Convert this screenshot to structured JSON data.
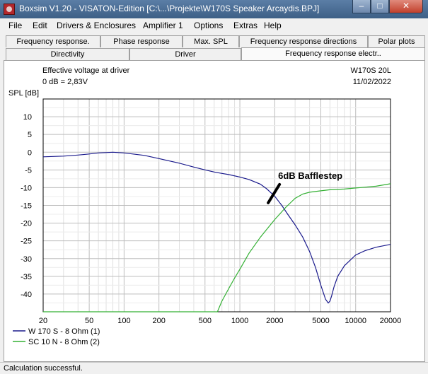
{
  "window": {
    "title": "Boxsim V1.20 - VISATON-Edition [C:\\...\\Projekte\\W170S Speaker Arcaydis.BPJ]",
    "minimize_glyph": "–",
    "maximize_glyph": "□",
    "close_glyph": "✕"
  },
  "menu": [
    "File",
    "Edit",
    "Drivers & Enclosures",
    "Amplifier 1",
    "Options",
    "Extras",
    "Help"
  ],
  "tabs_row1": [
    "Frequency response.",
    "Phase response",
    "Max. SPL",
    "Frequency response directions",
    "Polar plots"
  ],
  "tabs_row2": [
    "Directivity",
    "Driver",
    "Frequency response electr.."
  ],
  "active_tab": "Frequency response electr..",
  "header": {
    "left_line1": "Effective voltage at driver",
    "left_line2": "0 dB = 2,83V",
    "right_line1": "W170S 20L",
    "right_line2": "11/02/2022"
  },
  "status": "Calculation successful.",
  "chart_data": {
    "type": "line",
    "x_scale": "log",
    "xlim": [
      20,
      20000
    ],
    "ylim": [
      -45,
      15
    ],
    "ylabel": "SPL [dB]",
    "grid": true,
    "legend_position": "bottom-left",
    "x_tick_labels": [
      20,
      50,
      100,
      200,
      500,
      1000,
      2000,
      5000,
      10000,
      20000
    ],
    "y_tick_labels": [
      10,
      5,
      0,
      -5,
      -10,
      -15,
      -20,
      -25,
      -30,
      -35,
      -40
    ],
    "annotation": {
      "text": "6dB Bafflestep",
      "at_hz": 2200,
      "at_db": -7.5
    },
    "series": [
      {
        "name": "W 170 S - 8 Ohm (1)",
        "color": "#1a1a8c",
        "x": [
          20,
          30,
          40,
          50,
          60,
          70,
          80,
          100,
          150,
          200,
          300,
          400,
          500,
          600,
          700,
          800,
          1000,
          1200,
          1500,
          1700,
          2000,
          2300,
          2600,
          3000,
          3500,
          4000,
          4500,
          5000,
          5500,
          5800,
          6000,
          6200,
          6500,
          7000,
          8000,
          10000,
          12000,
          15000,
          20000
        ],
        "y": [
          -1.3,
          -1.1,
          -0.8,
          -0.5,
          -0.2,
          -0.1,
          0,
          -0.2,
          -0.9,
          -1.8,
          -3.1,
          -4.2,
          -5,
          -5.6,
          -6,
          -6.3,
          -7,
          -7.7,
          -9,
          -10.3,
          -12.4,
          -15,
          -17.6,
          -20.5,
          -24,
          -28,
          -32.5,
          -37.5,
          -41.5,
          -42.5,
          -42,
          -40.5,
          -38,
          -35,
          -32,
          -29,
          -27.8,
          -26.8,
          -26
        ]
      },
      {
        "name": "SC 10 N - 8 Ohm (2)",
        "color": "#33b033",
        "x": [
          20,
          100,
          300,
          640,
          700,
          800,
          900,
          1000,
          1200,
          1500,
          2000,
          2500,
          3000,
          3500,
          4000,
          5000,
          6000,
          8000,
          10000,
          15000,
          20000
        ],
        "y": [
          -46,
          -46,
          -46,
          -46,
          -42,
          -38.5,
          -35.5,
          -33,
          -28.5,
          -24,
          -19,
          -15.5,
          -13,
          -11.8,
          -11.3,
          -10.9,
          -10.6,
          -10.4,
          -10.1,
          -9.6,
          -8.9
        ]
      }
    ]
  }
}
